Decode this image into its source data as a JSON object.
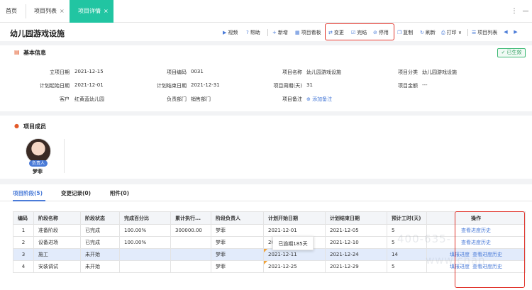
{
  "tabs": [
    {
      "label": "首页"
    },
    {
      "label": "项目列表",
      "close": "×"
    },
    {
      "label": "项目详情",
      "close": "×"
    }
  ],
  "window_controls": {
    "more": "⋮",
    "minimize": "—"
  },
  "header": {
    "title": "幼儿园游戏设施",
    "toolbar": [
      {
        "label": "视频",
        "icon": "▶"
      },
      {
        "label": "帮助",
        "icon": "?"
      },
      {
        "label": "新增",
        "icon": "+"
      },
      {
        "label": "项目看板",
        "icon": "▦"
      },
      {
        "label": "变更",
        "icon": "⇄"
      },
      {
        "label": "完结",
        "icon": "☑"
      },
      {
        "label": "停用",
        "icon": "⊘"
      },
      {
        "label": "复制",
        "icon": "❐"
      },
      {
        "label": "刷新",
        "icon": "↻"
      },
      {
        "label": "打印",
        "icon": "⎙",
        "caret": "∨"
      },
      {
        "label": "项目列表",
        "icon": "☰"
      }
    ],
    "nav_prev": "◀",
    "nav_next": "▶",
    "highlight_color": "#e0332a"
  },
  "basic_info": {
    "title": "基本信息",
    "status": "已生效",
    "rows": [
      [
        {
          "label": "立项日期",
          "value": "2021-12-15"
        },
        {
          "label": "项目编码",
          "value": "0031"
        },
        {
          "label": "项目名称",
          "value": "幼儿园游戏设施"
        },
        {
          "label": "项目分类",
          "value": "幼儿园游戏设施"
        }
      ],
      [
        {
          "label": "计划起始日期",
          "value": "2021-12-01"
        },
        {
          "label": "计划结束日期",
          "value": "2021-12-31"
        },
        {
          "label": "项目周期(天)",
          "value": "31"
        },
        {
          "label": "项目金额",
          "value": "---"
        }
      ],
      [
        {
          "label": "客户",
          "value": "红黄蓝幼儿园"
        },
        {
          "label": "负责部门",
          "value": "销售部门"
        },
        {
          "label": "项目备注",
          "value": "添加备注",
          "icon": "⊕"
        }
      ]
    ]
  },
  "members": {
    "title": "项目成员",
    "people": [
      {
        "role": "负责人",
        "name": "梦菲"
      }
    ]
  },
  "subtabs": [
    "项目阶段(5)",
    "变更记录(0)",
    "附件(0)"
  ],
  "table": {
    "headers": [
      "编码",
      "阶段名称",
      "阶段状态",
      "完成百分比",
      "累计执行...",
      "阶段负责人",
      "计划开始日期",
      "计划结束日期",
      "预计工时(天)",
      "操作"
    ],
    "rows": [
      {
        "code": "1",
        "name": "准备阶段",
        "status": "已完成",
        "percent": "100.00%",
        "amount": "300000.00",
        "owner": "梦菲",
        "start": "2021-12-01",
        "end": "2021-12-05",
        "days": "5",
        "ops": [
          "查看进度历史"
        ]
      },
      {
        "code": "2",
        "name": "设备进场",
        "status": "已完成",
        "percent": "100.00%",
        "amount": "",
        "owner": "梦菲",
        "start": "2021-12-06",
        "end": "2021-12-10",
        "days": "5",
        "ops": [
          "查看进度历史"
        ]
      },
      {
        "code": "3",
        "name": "施工",
        "status": "未开始",
        "percent": "",
        "amount": "",
        "owner": "梦菲",
        "start": "2021-12-11",
        "end": "2021-12-24",
        "days": "14",
        "ops": [
          "填报进度",
          "查看进度历史"
        ]
      },
      {
        "code": "4",
        "name": "安装调试",
        "status": "未开始",
        "percent": "",
        "amount": "",
        "owner": "梦菲",
        "start": "2021-12-25",
        "end": "2021-12-29",
        "days": "5",
        "ops": [
          "填报进度",
          "查看进度历史"
        ]
      }
    ],
    "tooltip": "已逾期185天"
  },
  "watermark": {
    "line1": "400-635-",
    "line2": "www.chan"
  }
}
